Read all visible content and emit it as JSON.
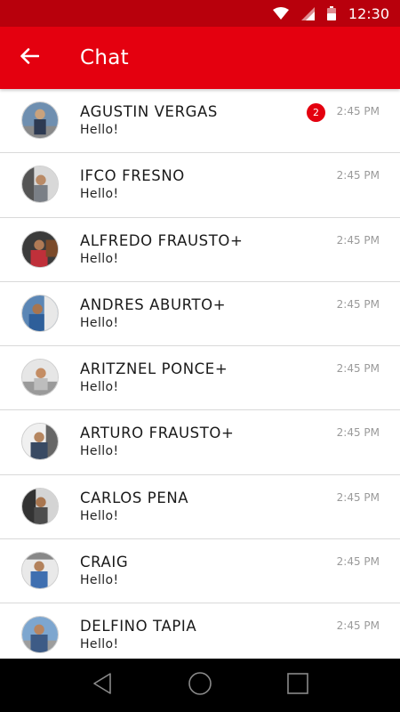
{
  "status_bar": {
    "time": "12:30",
    "icons": [
      "wifi-icon",
      "cell-signal-icon",
      "battery-icon"
    ]
  },
  "app_bar": {
    "title": "Chat",
    "back_icon": "arrow-left-icon",
    "color": "#e4000f"
  },
  "chats": [
    {
      "name": "AGUSTIN VERGAS",
      "message": "Hello!",
      "time": "2:45 PM",
      "unread": "2"
    },
    {
      "name": "IFCO FRESNO",
      "message": "Hello!",
      "time": "2:45 PM",
      "unread": null
    },
    {
      "name": "ALFREDO FRAUSTO+",
      "message": "Hello!",
      "time": "2:45 PM",
      "unread": null
    },
    {
      "name": "ANDRES ABURTO+",
      "message": "Hello!",
      "time": "2:45 PM",
      "unread": null
    },
    {
      "name": "ARITZNEL PONCE+",
      "message": "Hello!",
      "time": "2:45 PM",
      "unread": null
    },
    {
      "name": "ARTURO FRAUSTO+",
      "message": "Hello!",
      "time": "2:45 PM",
      "unread": null
    },
    {
      "name": "CARLOS PENA",
      "message": "Hello!",
      "time": "2:45 PM",
      "unread": null
    },
    {
      "name": "CRAIG",
      "message": "Hello!",
      "time": "2:45 PM",
      "unread": null
    },
    {
      "name": "DELFINO TAPIA",
      "message": "Hello!",
      "time": "2:45 PM",
      "unread": null
    }
  ],
  "nav_bar": {
    "icons": [
      "back-triangle-icon",
      "home-circle-icon",
      "recents-square-icon"
    ]
  }
}
